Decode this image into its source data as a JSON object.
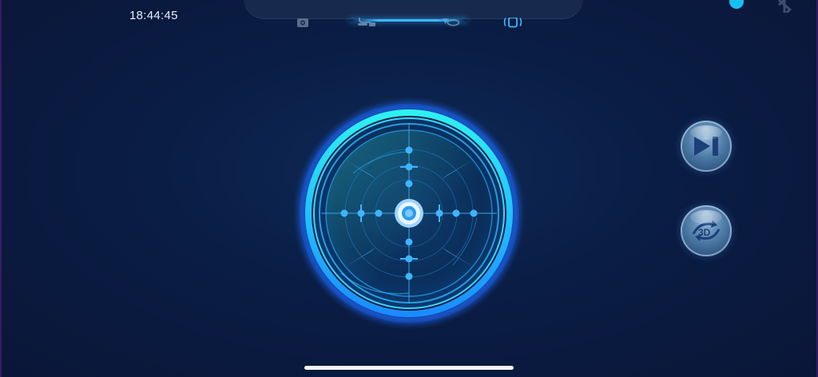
{
  "status_bar": {
    "time": "18:44:45"
  },
  "tabs": [
    {
      "name": "camera-icon",
      "active": false
    },
    {
      "name": "route-icon",
      "active": false
    },
    {
      "name": "map-pin-icon",
      "active": false
    },
    {
      "name": "vibrate-icon",
      "active": true
    }
  ],
  "connection": {
    "status_color": "#18c0f2",
    "bluetooth_icon": "bluetooth-icon"
  },
  "joystick": {
    "icon": "crosshair-joystick-icon"
  },
  "side_buttons": [
    {
      "name": "play-pause-button",
      "icon": "play-pause-icon"
    },
    {
      "name": "rotate-3d-button",
      "icon": "rotate-3d-icon"
    }
  ],
  "colors": {
    "accent": "#2aa8ff",
    "background": "#0a1d44"
  }
}
